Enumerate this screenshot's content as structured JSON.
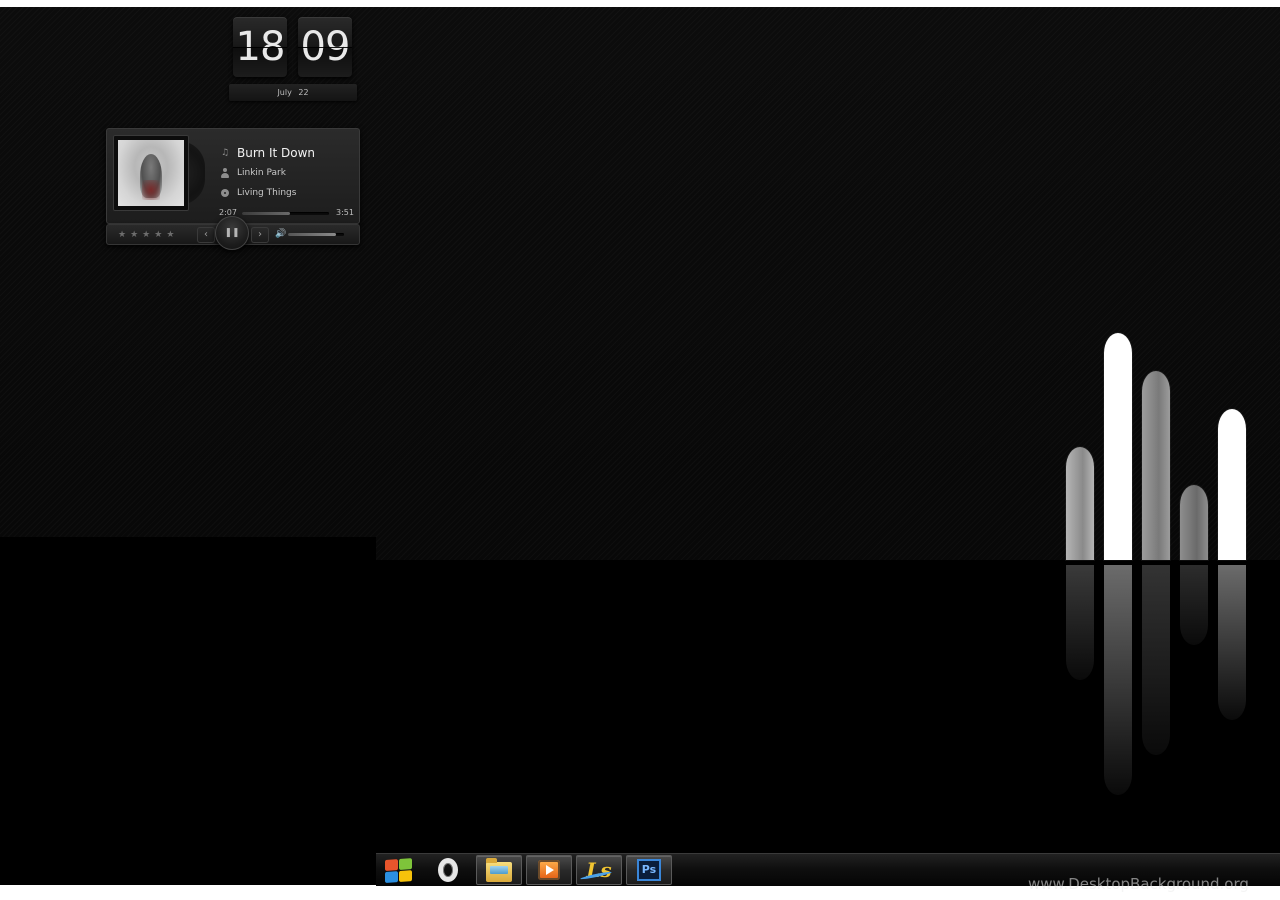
{
  "clock": {
    "hours": "18",
    "minutes": "09",
    "month": "July",
    "day": "22"
  },
  "player": {
    "title": "Burn It Down",
    "artist": "Linkin Park",
    "album": "Living Things",
    "elapsed": "2:07",
    "total": "3:51",
    "progress": 0.55,
    "volume": 0.85,
    "rating_stars": [
      "★",
      "★",
      "★",
      "★",
      "★"
    ],
    "prev_label": "‹",
    "next_label": "›",
    "pause_label": "❚❚",
    "volume_icon": "🔊"
  },
  "taskbar": {
    "items": [
      {
        "name": "start-button",
        "icon": "windows-logo-icon"
      },
      {
        "name": "opera",
        "icon": "opera-icon"
      },
      {
        "name": "file-explorer",
        "icon": "folder-icon"
      },
      {
        "name": "media-player",
        "icon": "media-player-icon"
      },
      {
        "name": "ls-app",
        "icon": "ls-icon",
        "text": "Ls"
      },
      {
        "name": "photoshop",
        "icon": "photoshop-icon",
        "text": "Ps"
      }
    ]
  },
  "logo_bars": [
    {
      "color": "#8a8a8a",
      "top_color": "#b5b5b5"
    },
    {
      "color": "#ffffff",
      "top_color": "#ffffff"
    },
    {
      "color": "#7a7a7a",
      "top_color": "#9c9c9c"
    },
    {
      "color": "#6a6a6a",
      "top_color": "#8e8e8e"
    },
    {
      "color": "#ffffff",
      "top_color": "#ffffff"
    }
  ],
  "watermark": "www.DesktopBackground.org"
}
